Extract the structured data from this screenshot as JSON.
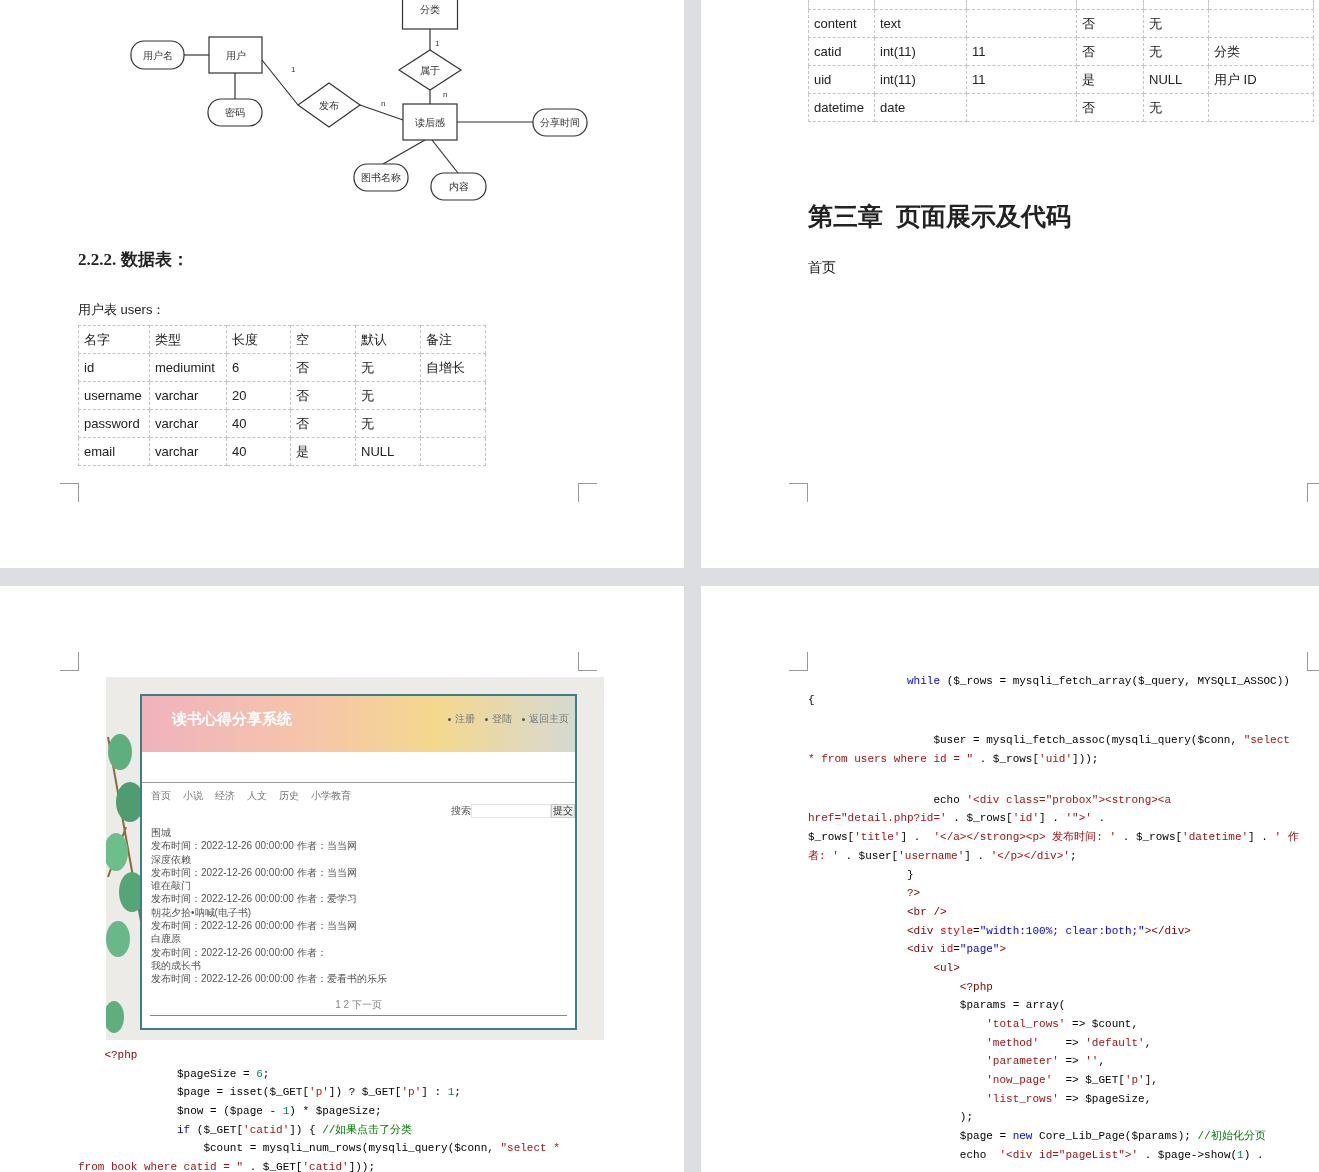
{
  "er_diagram": {
    "nodes": [
      {
        "kind": "entity",
        "label": "分类"
      },
      {
        "kind": "attribute",
        "label": "用户名"
      },
      {
        "kind": "entity",
        "label": "用户"
      },
      {
        "kind": "attribute",
        "label": "密码"
      },
      {
        "kind": "relationship",
        "label": "发布"
      },
      {
        "kind": "relationship",
        "label": "属于"
      },
      {
        "kind": "entity",
        "label": "读后感"
      },
      {
        "kind": "attribute",
        "label": "分享时间"
      },
      {
        "kind": "attribute",
        "label": "图书名称"
      },
      {
        "kind": "attribute",
        "label": "内容"
      }
    ],
    "cardinalities": [
      "1",
      "n",
      "1",
      "n"
    ]
  },
  "section_heading": "2.2.2. 数据表：",
  "users_table": {
    "caption": "用户表 users：",
    "columns": [
      "名字",
      "类型",
      "长度",
      "空",
      "默认",
      "备注"
    ],
    "rows": [
      [
        "id",
        "mediumint",
        "6",
        "否",
        "无",
        "自增长"
      ],
      [
        "username",
        "varchar",
        "20",
        "否",
        "无",
        null
      ],
      [
        "password",
        "varchar",
        "40",
        "否",
        "无",
        null
      ],
      [
        "email",
        "varchar",
        "40",
        "是",
        "NULL",
        null
      ]
    ]
  },
  "books_table": {
    "rows": [
      [
        "content",
        "text",
        null,
        "否",
        "无",
        null
      ],
      [
        "catid",
        "int(11)",
        "11",
        "否",
        "无",
        "分类"
      ],
      [
        "uid",
        "int(11)",
        "11",
        "是",
        "NULL",
        "用户 ID"
      ],
      [
        "datetime",
        "date",
        null,
        "否",
        "无",
        null
      ]
    ]
  },
  "chapter_heading": "第三章  页面展示及代码",
  "paragraph": "首页",
  "app_screenshot": {
    "site_title": "读书心得分享系统",
    "header_links": [
      "注册",
      "登陆",
      "返回主页"
    ],
    "nav": [
      "首页",
      "小说",
      "经济",
      "人文",
      "历史",
      "小学教育"
    ],
    "search_label": "搜索",
    "search_button": "提交",
    "posts": [
      {
        "title": "围城",
        "meta": "发布时间：2022-12-26 00:00:00 作者：当当网"
      },
      {
        "title": "深度依赖",
        "meta": "发布时间：2022-12-26 00:00:00 作者：当当网"
      },
      {
        "title": "谁在敲门",
        "meta": "发布时间：2022-12-26 00:00:00 作者：爱学习"
      },
      {
        "title": "朝花夕拾•呐喊(电子书)",
        "meta": "发布时间：2022-12-26 00:00:00 作者：当当网"
      },
      {
        "title": "白鹿原",
        "meta": "发布时间：2022-12-26 00:00:00 作者："
      },
      {
        "title": "我的成长书",
        "meta": "发布时间：2022-12-26 00:00:00 作者：爱看书的乐乐"
      }
    ],
    "pagination": "1 2 下一页"
  },
  "code_left": [
    {
      "segments": [
        {
          "kind": "tag",
          "text": "    <?php"
        }
      ]
    },
    {
      "segments": [
        {
          "kind": "plain",
          "text": "               $pageSize = "
        },
        {
          "kind": "number",
          "text": "6"
        },
        {
          "kind": "plain",
          "text": ";"
        }
      ]
    },
    {
      "segments": [
        {
          "kind": "plain",
          "text": "               $page = isset($_GET["
        },
        {
          "kind": "string",
          "text": "'p'"
        },
        {
          "kind": "plain",
          "text": "]) ? $_GET["
        },
        {
          "kind": "string",
          "text": "'p'"
        },
        {
          "kind": "plain",
          "text": "] : "
        },
        {
          "kind": "number",
          "text": "1"
        },
        {
          "kind": "plain",
          "text": ";"
        }
      ]
    },
    {
      "segments": [
        {
          "kind": "plain",
          "text": "               $now = ($page - "
        },
        {
          "kind": "number",
          "text": "1"
        },
        {
          "kind": "plain",
          "text": ") * $pageSize;"
        }
      ]
    },
    {
      "segments": [
        {
          "kind": "keyword",
          "text": "               if"
        },
        {
          "kind": "plain",
          "text": " ($_GET["
        },
        {
          "kind": "string",
          "text": "'catid'"
        },
        {
          "kind": "plain",
          "text": "]) { "
        },
        {
          "kind": "comment",
          "text": "//如果点击了分类"
        }
      ]
    },
    {
      "segments": [
        {
          "kind": "plain",
          "text": "                   $count = mysqli_num_rows(mysqli_query($conn, "
        },
        {
          "kind": "string",
          "text": "\"select *"
        }
      ]
    },
    {
      "segments": [
        {
          "kind": "string",
          "text": "from book where catid = \""
        },
        {
          "kind": "plain",
          "text": " . $_GET["
        },
        {
          "kind": "string",
          "text": "'catid'"
        },
        {
          "kind": "plain",
          "text": "]));"
        }
      ]
    }
  ],
  "code_right": [
    [
      {
        "segments": [
          {
            "kind": "keyword",
            "text": "               while"
          },
          {
            "kind": "plain",
            "text": " ($_rows = mysqli_fetch_array($_query, MYSQLI_ASSOC))"
          }
        ]
      },
      {
        "segments": [
          {
            "kind": "plain",
            "text": "{"
          }
        ]
      }
    ],
    [
      {
        "segments": [
          {
            "kind": "plain",
            "text": "                   $user = mysqli_fetch_assoc(mysqli_query($conn, "
          },
          {
            "kind": "string",
            "text": "\"select"
          }
        ]
      },
      {
        "segments": [
          {
            "kind": "string",
            "text": "* from users where id = \""
          },
          {
            "kind": "plain",
            "text": " . $_rows["
          },
          {
            "kind": "string",
            "text": "'uid'"
          },
          {
            "kind": "plain",
            "text": "]));"
          }
        ]
      }
    ],
    [
      {
        "segments": [
          {
            "kind": "plain",
            "text": "                   echo "
          },
          {
            "kind": "string",
            "text": "'<div class=\"probox\"><strong><a"
          }
        ]
      },
      {
        "segments": [
          {
            "kind": "string",
            "text": "href=\"detail.php?id='"
          },
          {
            "kind": "plain",
            "text": " . $_rows["
          },
          {
            "kind": "string",
            "text": "'id'"
          },
          {
            "kind": "plain",
            "text": "] . "
          },
          {
            "kind": "string",
            "text": "'\">'"
          },
          {
            "kind": "plain",
            "text": " ."
          }
        ]
      },
      {
        "segments": [
          {
            "kind": "plain",
            "text": "$_rows["
          },
          {
            "kind": "string",
            "text": "'title'"
          },
          {
            "kind": "plain",
            "text": "] .  "
          },
          {
            "kind": "string",
            "text": "'</a></strong><p> 发布时间: '"
          },
          {
            "kind": "plain",
            "text": " . $_rows["
          },
          {
            "kind": "string",
            "text": "'datetime'"
          },
          {
            "kind": "plain",
            "text": "] . "
          },
          {
            "kind": "string",
            "text": "' 作"
          }
        ]
      },
      {
        "segments": [
          {
            "kind": "string",
            "text": "者: '"
          },
          {
            "kind": "plain",
            "text": " . $user["
          },
          {
            "kind": "string",
            "text": "'username'"
          },
          {
            "kind": "plain",
            "text": "] . "
          },
          {
            "kind": "string",
            "text": "'</p></div>'"
          },
          {
            "kind": "plain",
            "text": ";"
          }
        ]
      },
      {
        "segments": [
          {
            "kind": "plain",
            "text": "               }"
          }
        ]
      },
      {
        "segments": [
          {
            "kind": "tag",
            "text": "               ?>"
          }
        ]
      },
      {
        "segments": [
          {
            "kind": "tag",
            "text": "               <br />"
          }
        ]
      },
      {
        "segments": [
          {
            "kind": "tag",
            "text": "               <div "
          },
          {
            "kind": "attr",
            "text": "style"
          },
          {
            "kind": "plain",
            "text": "="
          },
          {
            "kind": "value",
            "text": "\"width:100%; clear:both;\""
          },
          {
            "kind": "tag",
            "text": "></div>"
          }
        ]
      },
      {
        "segments": [
          {
            "kind": "tag",
            "text": "               <div "
          },
          {
            "kind": "attr",
            "text": "id"
          },
          {
            "kind": "plain",
            "text": "="
          },
          {
            "kind": "value",
            "text": "\"page\""
          },
          {
            "kind": "tag",
            "text": ">"
          }
        ]
      },
      {
        "segments": [
          {
            "kind": "tag",
            "text": "                   <ul>"
          }
        ]
      },
      {
        "segments": [
          {
            "kind": "tag",
            "text": "                       <?php"
          }
        ]
      },
      {
        "segments": [
          {
            "kind": "plain",
            "text": "                       $params = array("
          }
        ]
      },
      {
        "segments": [
          {
            "kind": "string",
            "text": "                           'total_rows'"
          },
          {
            "kind": "plain",
            "text": " => $count,"
          }
        ]
      },
      {
        "segments": [
          {
            "kind": "string",
            "text": "                           'method'"
          },
          {
            "kind": "plain",
            "text": "    => "
          },
          {
            "kind": "string",
            "text": "'default'"
          },
          {
            "kind": "plain",
            "text": ","
          }
        ]
      },
      {
        "segments": [
          {
            "kind": "string",
            "text": "                           'parameter'"
          },
          {
            "kind": "plain",
            "text": " => "
          },
          {
            "kind": "string",
            "text": "''"
          },
          {
            "kind": "plain",
            "text": ","
          }
        ]
      },
      {
        "segments": [
          {
            "kind": "string",
            "text": "                           'now_page'"
          },
          {
            "kind": "plain",
            "text": "  => $_GET["
          },
          {
            "kind": "string",
            "text": "'p'"
          },
          {
            "kind": "plain",
            "text": "],"
          }
        ]
      },
      {
        "segments": [
          {
            "kind": "string",
            "text": "                           'list_rows'"
          },
          {
            "kind": "plain",
            "text": " => $pageSize,"
          }
        ]
      },
      {
        "segments": [
          {
            "kind": "plain",
            "text": "                       );"
          }
        ]
      },
      {
        "segments": [
          {
            "kind": "plain",
            "text": "                       $page = "
          },
          {
            "kind": "keyword",
            "text": "new"
          },
          {
            "kind": "plain",
            "text": " Core_Lib_Page($params); "
          },
          {
            "kind": "comment",
            "text": "//初始化分页"
          }
        ]
      },
      {
        "segments": [
          {
            "kind": "plain",
            "text": "                       echo  "
          },
          {
            "kind": "string",
            "text": "'<div id=\"pageList\">'"
          },
          {
            "kind": "plain",
            "text": " . $page->show("
          },
          {
            "kind": "number",
            "text": "1"
          },
          {
            "kind": "plain",
            "text": ") ."
          }
        ]
      }
    ]
  ]
}
